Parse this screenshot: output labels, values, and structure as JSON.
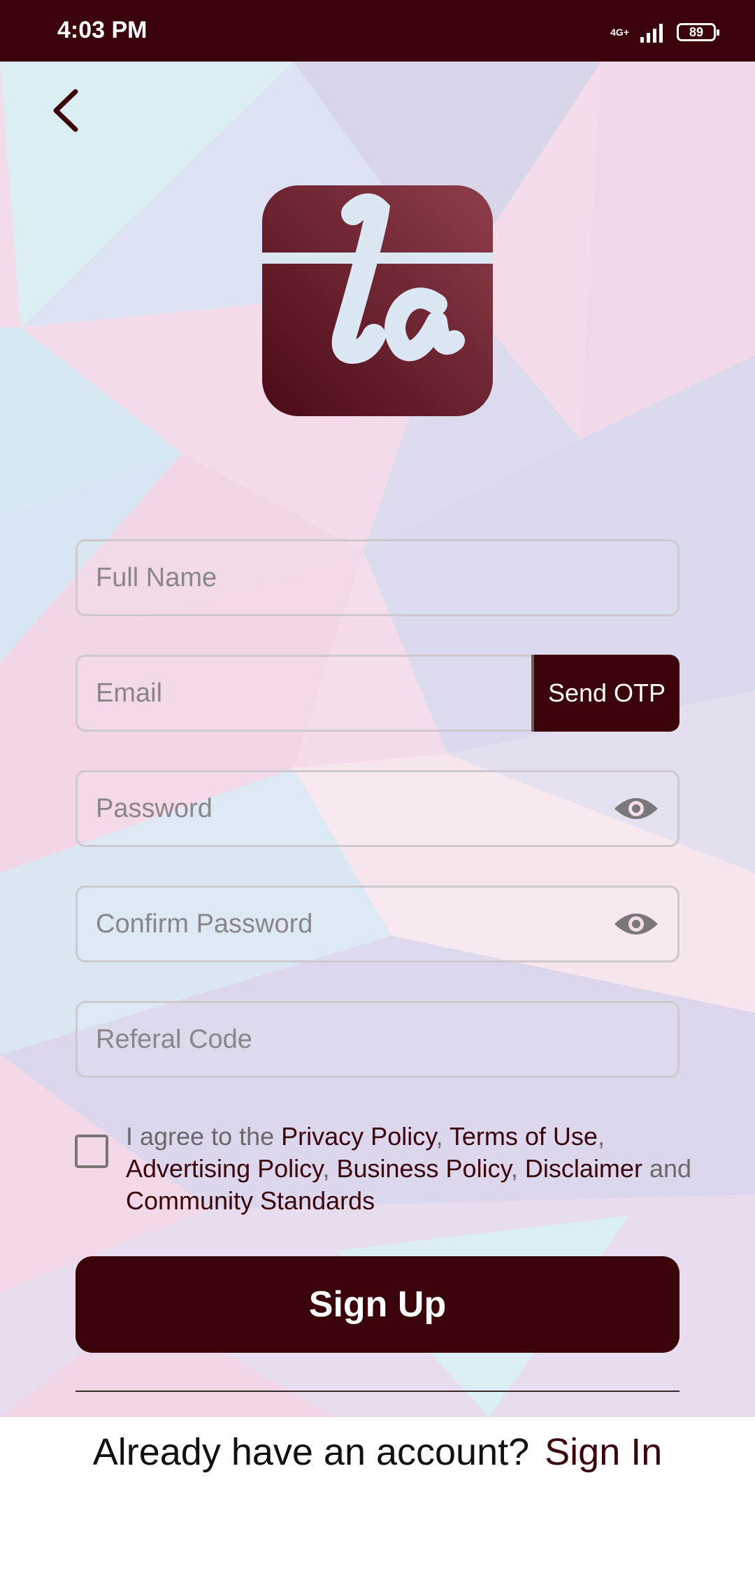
{
  "status_bar": {
    "time": "4:03 PM",
    "network": "4G+",
    "battery": "89"
  },
  "icons": {
    "back": "back-arrow-icon",
    "logo": "ta-logo",
    "eye": "eye-icon"
  },
  "form": {
    "full_name_placeholder": "Full Name",
    "email_placeholder": "Email",
    "send_otp_label": "Send OTP",
    "password_placeholder": "Password",
    "confirm_password_placeholder": "Confirm Password",
    "referral_placeholder": "Referal Code"
  },
  "agreement": {
    "prefix": "I agree to the ",
    "privacy": "Privacy Policy",
    "sep1": ", ",
    "terms": "Terms of Use",
    "sep2": ", ",
    "advertising": "Advertising Policy",
    "sep3": ", ",
    "business": "Business Policy",
    "sep4": ", ",
    "disclaimer": "Disclaimer",
    "and": " and ",
    "community": "Community Standards"
  },
  "signup_label": "Sign Up",
  "signin": {
    "prompt": "Already have an account?",
    "link": "Sign In"
  },
  "colors": {
    "primary": "#3b030a",
    "placeholder": "#8a8589",
    "border": "#cfc9cf"
  }
}
